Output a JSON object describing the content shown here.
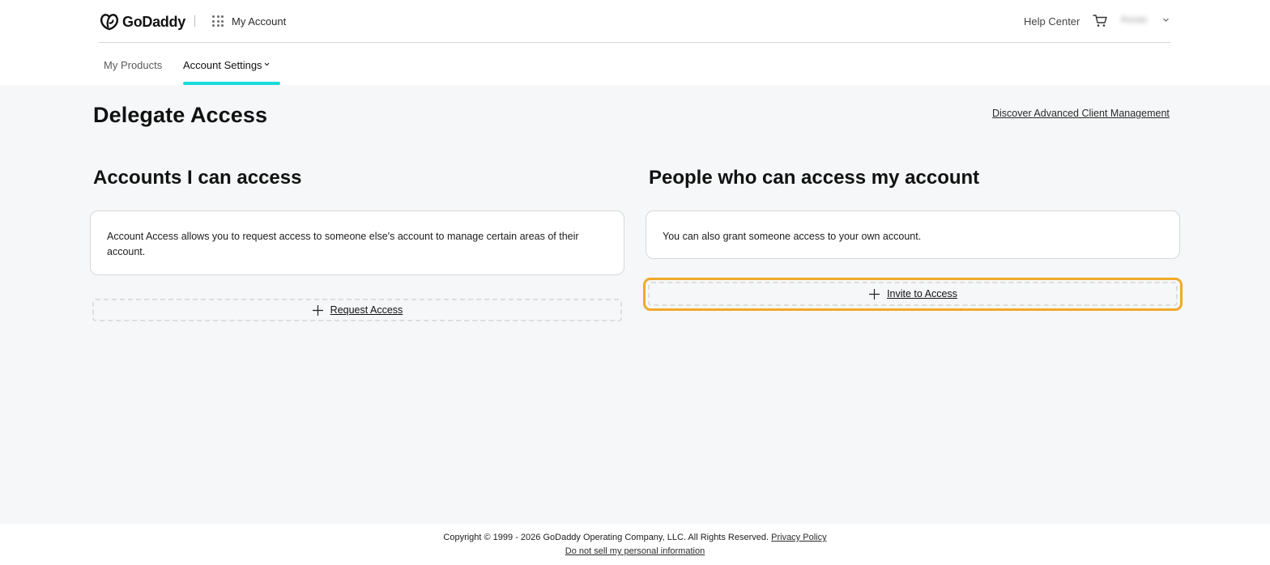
{
  "header": {
    "brand": "GoDaddy",
    "app_title": "My Account",
    "help_center": "Help Center",
    "user_name": "Rondo"
  },
  "nav": {
    "tabs": [
      {
        "label": "My Products"
      },
      {
        "label": "Account Settings",
        "active": true
      }
    ]
  },
  "main": {
    "title": "Delegate Access",
    "discover_link": "Discover Advanced Client Management",
    "left": {
      "title": "Accounts I can access",
      "description": "Account Access allows you to request access to someone else's account to manage certain areas of their account.",
      "button_label": "Request Access"
    },
    "right": {
      "title": "People who can access my account",
      "description": "You can also grant someone access to your own account.",
      "button_label": "Invite to Access"
    }
  },
  "footer": {
    "copyright": "Copyright © 1999 - 2026 GoDaddy Operating Company, LLC. All Rights Reserved.",
    "privacy_policy": "Privacy Policy",
    "do_not_sell": "Do not sell my personal information"
  },
  "colors": {
    "accent_tab_underline": "#1bdbdb",
    "focus_ring": "#f0a92b",
    "page_background": "#f5f7f8"
  },
  "icons": [
    "godaddy-logo-icon",
    "apps-grid-icon",
    "cart-icon",
    "chevron-down-icon",
    "plus-icon"
  ]
}
